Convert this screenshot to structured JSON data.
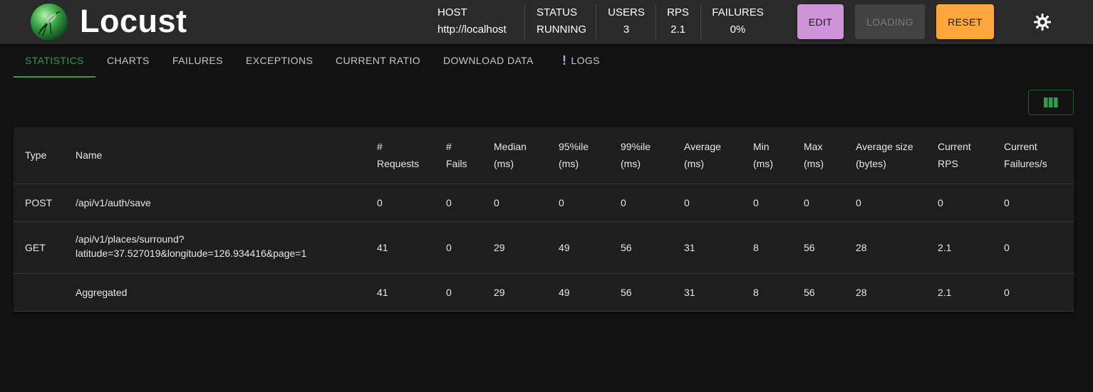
{
  "app": {
    "title": "Locust"
  },
  "header": {
    "stats": [
      {
        "label": "HOST",
        "value": "http://localhost"
      },
      {
        "label": "STATUS",
        "value": "RUNNING"
      },
      {
        "label": "USERS",
        "value": "3"
      },
      {
        "label": "RPS",
        "value": "2.1"
      },
      {
        "label": "FAILURES",
        "value": "0%"
      }
    ],
    "buttons": {
      "edit": "EDIT",
      "loading": "LOADING",
      "reset": "RESET"
    },
    "theme_icon": "sun-icon"
  },
  "tabs": [
    {
      "label": "STATISTICS",
      "active": true
    },
    {
      "label": "CHARTS"
    },
    {
      "label": "FAILURES"
    },
    {
      "label": "EXCEPTIONS"
    },
    {
      "label": "CURRENT RATIO"
    },
    {
      "label": "DOWNLOAD DATA"
    },
    {
      "label": "LOGS",
      "icon": "warning-icon"
    }
  ],
  "toolbar": {
    "columns_icon": "view-columns-icon"
  },
  "table": {
    "headers": [
      [
        "Type"
      ],
      [
        "Name"
      ],
      [
        "#",
        "Requests"
      ],
      [
        "#",
        "Fails"
      ],
      [
        "Median",
        "(ms)"
      ],
      [
        "95%ile",
        "(ms)"
      ],
      [
        "99%ile",
        "(ms)"
      ],
      [
        "Average",
        "(ms)"
      ],
      [
        "Min",
        "(ms)"
      ],
      [
        "Max",
        "(ms)"
      ],
      [
        "Average size",
        "(bytes)"
      ],
      [
        "Current",
        "RPS"
      ],
      [
        "Current",
        "Failures/s"
      ]
    ],
    "rows": [
      {
        "type": "POST",
        "name": [
          "/api/v1/auth/save"
        ],
        "requests": "0",
        "fails": "0",
        "median": "0",
        "p95": "0",
        "p99": "0",
        "average": "0",
        "min": "0",
        "max": "0",
        "avg_size": "0",
        "current_rps": "0",
        "current_failures": "0"
      },
      {
        "type": "GET",
        "name": [
          "/api/v1/places/surround?",
          "latitude=37.527019&longitude=126.934416&page=1"
        ],
        "requests": "41",
        "fails": "0",
        "median": "29",
        "p95": "49",
        "p99": "56",
        "average": "31",
        "min": "8",
        "max": "56",
        "avg_size": "28",
        "current_rps": "2.1",
        "current_failures": "0"
      },
      {
        "type": "",
        "name": [
          "Aggregated"
        ],
        "requests": "41",
        "fails": "0",
        "median": "29",
        "p95": "49",
        "p99": "56",
        "average": "31",
        "min": "8",
        "max": "56",
        "avg_size": "28",
        "current_rps": "2.1",
        "current_failures": "0"
      }
    ]
  },
  "colors": {
    "header_bg": "#2a2a2a",
    "page_bg": "#121212",
    "accent_green": "#2e9e4f",
    "edit_purple": "#ce93d8",
    "reset_orange": "#ffa63d"
  }
}
